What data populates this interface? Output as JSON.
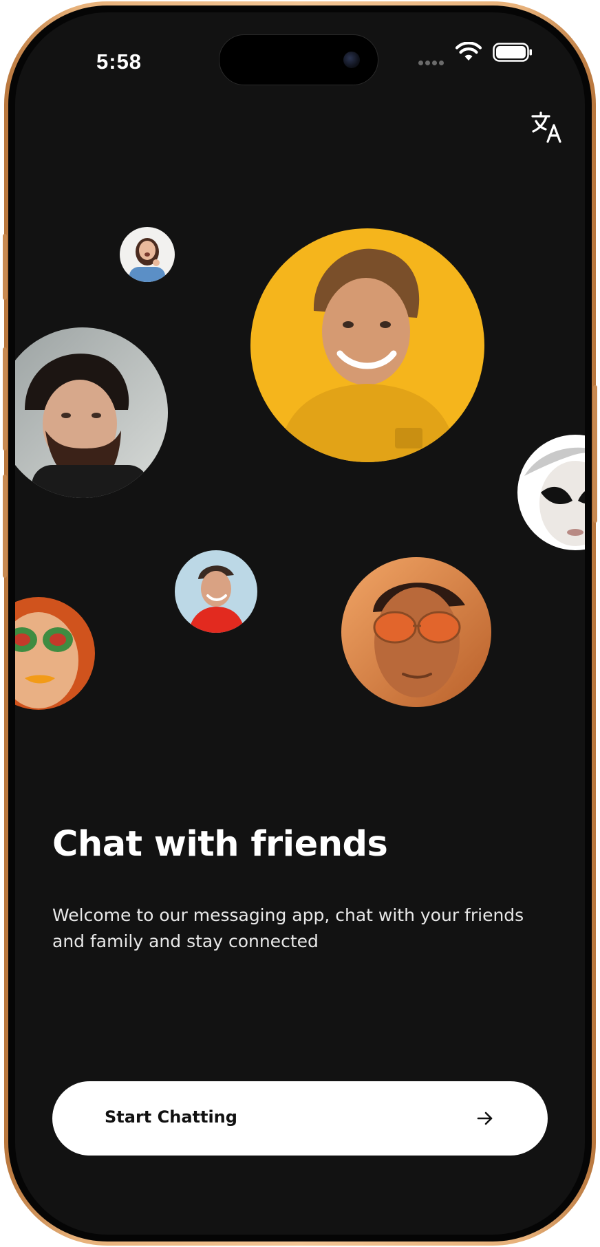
{
  "status_bar": {
    "time": "5:58"
  },
  "icons": {
    "translate": "translate-icon",
    "arrow": "arrow-right-icon",
    "wifi": "wifi-icon",
    "battery": "battery-icon"
  },
  "onboarding": {
    "title": "Chat with friends",
    "subtitle": "Welcome to our messaging app, chat with your friends and family and stay connected",
    "cta_label": "Start Chatting"
  },
  "colors": {
    "background": "#121212",
    "frame": "#e7b17a",
    "button_bg": "#ffffff",
    "button_text": "#111111"
  }
}
